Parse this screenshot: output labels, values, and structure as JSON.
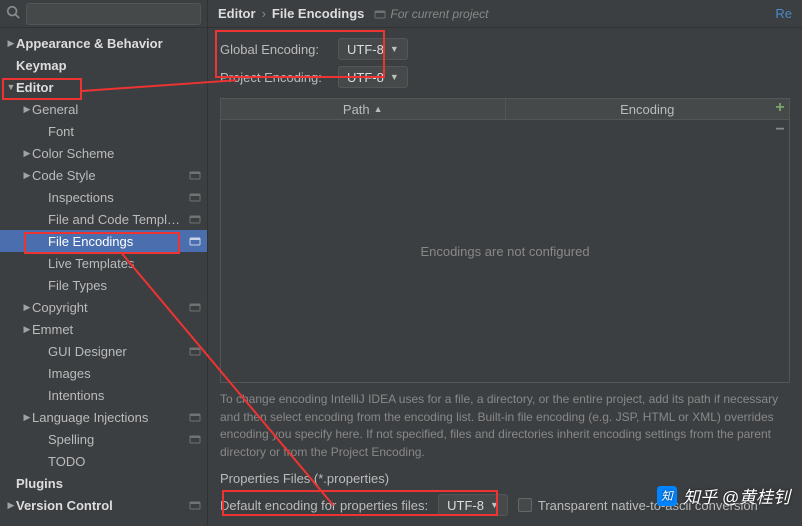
{
  "search": {
    "placeholder": ""
  },
  "tree": {
    "appearance": "Appearance & Behavior",
    "keymap": "Keymap",
    "editor": "Editor",
    "general": "General",
    "font": "Font",
    "color_scheme": "Color Scheme",
    "code_style": "Code Style",
    "inspections": "Inspections",
    "file_code_templates": "File and Code Templates",
    "file_encodings": "File Encodings",
    "live_templates": "Live Templates",
    "file_types": "File Types",
    "copyright": "Copyright",
    "emmet": "Emmet",
    "gui_designer": "GUI Designer",
    "images": "Images",
    "intentions": "Intentions",
    "lang_injections": "Language Injections",
    "spelling": "Spelling",
    "todo": "TODO",
    "plugins": "Plugins",
    "version_control": "Version Control"
  },
  "crumbs": {
    "p1": "Editor",
    "sep": "›",
    "p2": "File Encodings",
    "sub": "For current project",
    "reset": "Re"
  },
  "enc": {
    "global_label": "Global Encoding:",
    "global_val": "UTF-8",
    "project_label": "Project Encoding:",
    "project_val": "UTF-8"
  },
  "table": {
    "path": "Path",
    "encoding": "Encoding",
    "empty": "Encodings are not configured",
    "add": "+",
    "sub": "−"
  },
  "hint": "To change encoding IntelliJ IDEA uses for a file, a directory, or the entire project, add its path if necessary and then select encoding from the encoding list. Built-in file encoding (e.g. JSP, HTML or XML) overrides encoding you specify here. If not specified, files and directories inherit encoding settings from the parent directory or from the Project Encoding.",
  "props": {
    "section": "Properties Files (*.properties)",
    "label": "Default encoding for properties files:",
    "val": "UTF-8",
    "chk": "Transparent native-to-ascii conversion"
  },
  "watermark": "知乎 @黄桂钊"
}
